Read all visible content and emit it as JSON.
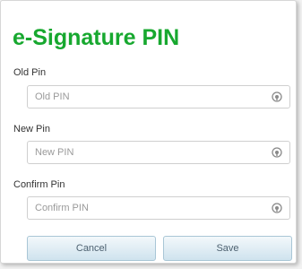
{
  "dialog": {
    "title": "e-Signature PIN",
    "title_color": "#17a82f"
  },
  "fields": [
    {
      "label": "Old Pin",
      "placeholder": "Old PIN",
      "icon": "eye-icon"
    },
    {
      "label": "New Pin",
      "placeholder": "New PIN",
      "icon": "eye-icon"
    },
    {
      "label": "Confirm Pin",
      "placeholder": "Confirm PIN",
      "icon": "eye-icon"
    }
  ],
  "buttons": {
    "cancel_label": "Cancel",
    "save_label": "Save"
  }
}
